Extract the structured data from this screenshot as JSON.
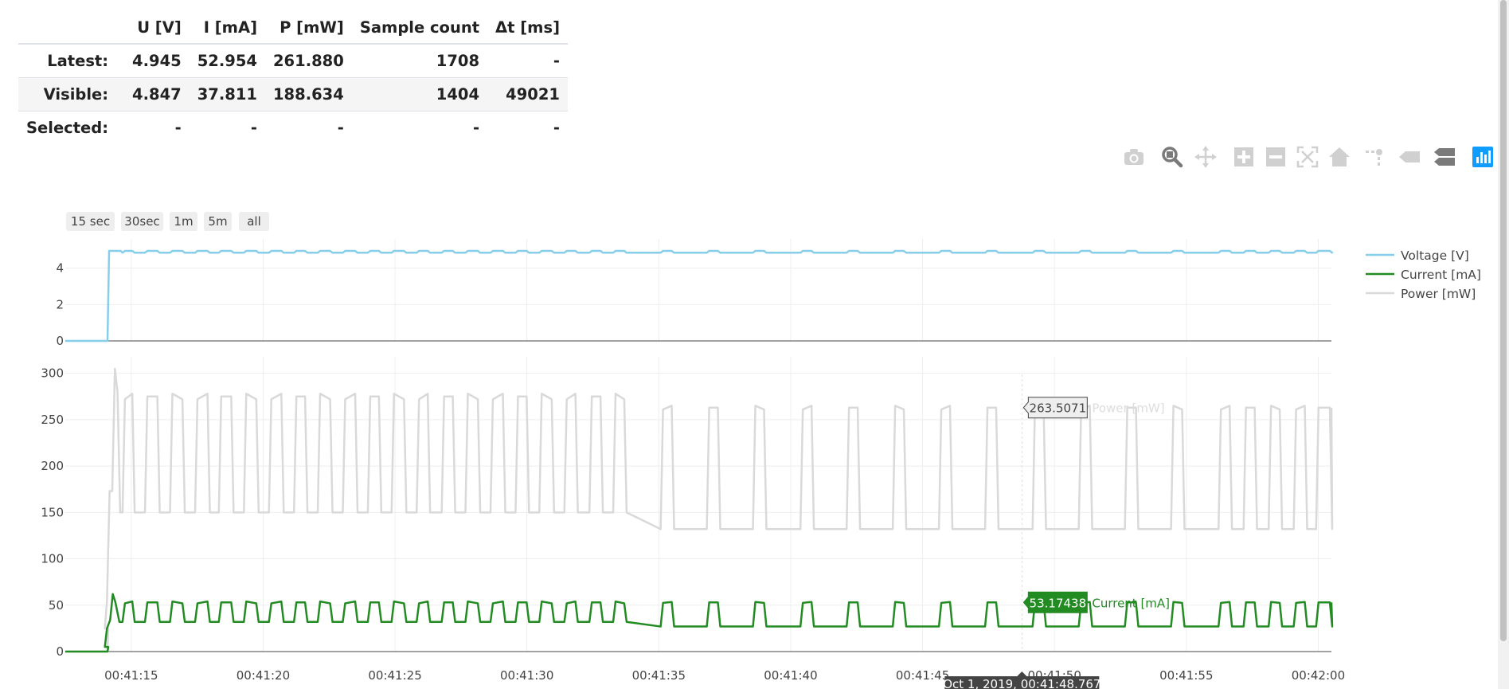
{
  "stats": {
    "headers": [
      "",
      "U [V]",
      "I [mA]",
      "P [mW]",
      "Sample count",
      "Δt [ms]"
    ],
    "rows": [
      {
        "label": "Latest:",
        "u": "4.945",
        "i": "52.954",
        "p": "261.880",
        "count": "1708",
        "dt": "-"
      },
      {
        "label": "Visible:",
        "u": "4.847",
        "i": "37.811",
        "p": "188.634",
        "count": "1404",
        "dt": "49021"
      },
      {
        "label": "Selected:",
        "u": "-",
        "i": "-",
        "p": "-",
        "count": "-",
        "dt": "-"
      }
    ]
  },
  "range_buttons": [
    "15 sec",
    "30sec",
    "1m",
    "5m",
    "all"
  ],
  "modebar": [
    "camera-icon",
    "zoom-icon",
    "pan-icon",
    "zoom-in-icon",
    "zoom-out-icon",
    "autoscale-icon",
    "reset-axes-icon",
    "spike-lines-icon",
    "hover-closest-icon",
    "hover-compare-icon",
    "plotly-logo-icon"
  ],
  "chart_data": {
    "type": "line",
    "x_ticks": [
      "00:41:15",
      "00:41:20",
      "00:41:25",
      "00:41:30",
      "00:41:35",
      "00:41:40",
      "00:41:45",
      "00:41:50",
      "00:41:55",
      "00:42:00"
    ],
    "x_range": [
      "00:41:12.5",
      "00:42:00.5"
    ],
    "top_panel": {
      "yticks": [
        0,
        2,
        4
      ],
      "ylim": [
        0,
        5.3
      ]
    },
    "bottom_panel": {
      "yticks": [
        0,
        50,
        100,
        150,
        200,
        250,
        300
      ],
      "ylim": [
        0,
        310
      ]
    },
    "series": [
      {
        "name": "Voltage [V]",
        "color": "#87ceeb",
        "panel": "top",
        "start": "00:41:14.1",
        "baseline": 0,
        "high": 4.95,
        "low": 4.85,
        "values": [
          0,
          0,
          4.95,
          4.95,
          4.85,
          4.9,
          4.85,
          4.9,
          4.85,
          4.9,
          4.85,
          4.9,
          4.85,
          4.9
        ]
      },
      {
        "name": "Current [mA]",
        "color": "#228b22",
        "panel": "bottom",
        "start": "00:41:14.1",
        "baseline": 0,
        "initial": 5,
        "high": 53,
        "low_early": 32,
        "low_late": 27,
        "peak": 62,
        "values": [
          0,
          5,
          25,
          34,
          62,
          53,
          32,
          53,
          32,
          53,
          27,
          53,
          27,
          53
        ]
      },
      {
        "name": "Power [mW]",
        "color": "#d9d9d9",
        "panel": "bottom",
        "start": "00:41:14.1",
        "baseline": 0,
        "initial": 25,
        "high": 263,
        "high_early": 275,
        "low_early": 150,
        "low_late": 132,
        "peak": 305,
        "values": [
          0,
          25,
          173,
          305,
          280,
          150,
          275,
          150,
          263,
          132,
          263,
          132,
          263
        ]
      }
    ],
    "early_cycles": [
      [
        "00:41:14.70",
        "00:41:15.10"
      ],
      [
        "00:41:15.55",
        "00:41:16.05"
      ],
      [
        "00:41:16.50",
        "00:41:17.00"
      ],
      [
        "00:41:17.45",
        "00:41:17.95"
      ],
      [
        "00:41:18.35",
        "00:41:18.85"
      ],
      [
        "00:41:19.30",
        "00:41:19.80"
      ],
      [
        "00:41:20.25",
        "00:41:20.75"
      ],
      [
        "00:41:21.20",
        "00:41:21.65"
      ],
      [
        "00:41:22.10",
        "00:41:22.60"
      ],
      [
        "00:41:23.05",
        "00:41:23.55"
      ],
      [
        "00:41:24.00",
        "00:41:24.45"
      ],
      [
        "00:41:24.90",
        "00:41:25.40"
      ],
      [
        "00:41:25.85",
        "00:41:26.30"
      ],
      [
        "00:41:26.80",
        "00:41:27.25"
      ],
      [
        "00:41:27.70",
        "00:41:28.20"
      ],
      [
        "00:41:28.65",
        "00:41:29.15"
      ],
      [
        "00:41:29.60",
        "00:41:30.05"
      ],
      [
        "00:41:30.50",
        "00:41:31.00"
      ],
      [
        "00:41:31.45",
        "00:41:31.90"
      ],
      [
        "00:41:32.40",
        "00:41:32.85"
      ],
      [
        "00:41:33.30",
        "00:41:33.75"
      ]
    ],
    "late_cycles": [
      [
        "00:41:35.10",
        "00:41:35.55"
      ],
      [
        "00:41:36.85",
        "00:41:37.30"
      ],
      [
        "00:41:38.60",
        "00:41:39.05"
      ],
      [
        "00:41:40.40",
        "00:41:40.85"
      ],
      [
        "00:41:42.15",
        "00:41:42.60"
      ],
      [
        "00:41:43.90",
        "00:41:44.35"
      ],
      [
        "00:41:45.65",
        "00:41:46.10"
      ],
      [
        "00:41:47.40",
        "00:41:47.85"
      ],
      [
        "00:41:49.20",
        "00:41:49.65"
      ],
      [
        "00:41:50.95",
        "00:41:51.40"
      ],
      [
        "00:41:52.70",
        "00:41:53.15"
      ],
      [
        "00:41:54.45",
        "00:41:54.90"
      ],
      [
        "00:41:56.25",
        "00:41:56.70"
      ],
      [
        "00:41:57.20",
        "00:41:57.65"
      ],
      [
        "00:41:58.15",
        "00:41:58.60"
      ],
      [
        "00:41:59.10",
        "00:41:59.55"
      ],
      [
        "00:41:59.95",
        "00:42:00.50"
      ]
    ],
    "hover": {
      "power_label": "263.5071",
      "power_name": "Power [mW]",
      "current_label": "53.17438",
      "current_name": "Current [mA]",
      "x_label": "Oct 1, 2019, 00:41:48.767"
    },
    "legend_position": "top-right"
  }
}
